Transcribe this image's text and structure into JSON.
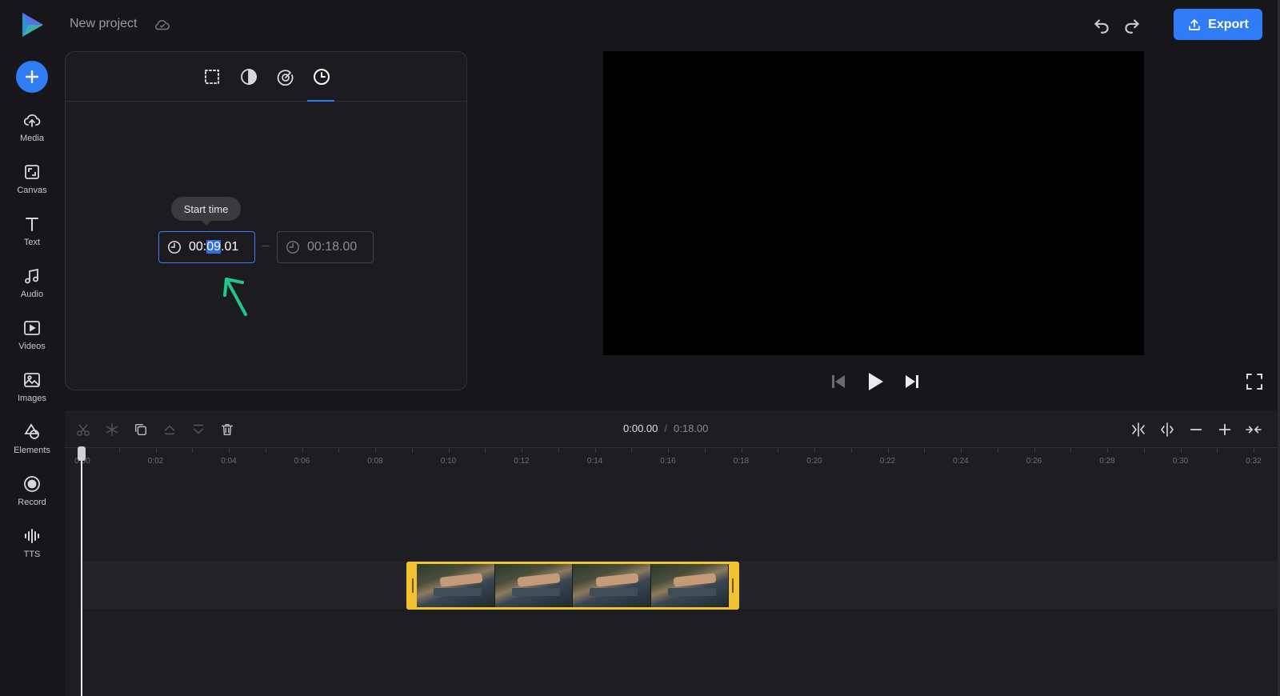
{
  "header": {
    "project_title": "New project",
    "export_label": "Export"
  },
  "sidebar": {
    "items": [
      {
        "label": "Media",
        "icon": "upload-cloud-icon"
      },
      {
        "label": "Canvas",
        "icon": "canvas-icon"
      },
      {
        "label": "Text",
        "icon": "text-icon"
      },
      {
        "label": "Audio",
        "icon": "music-note-icon"
      },
      {
        "label": "Videos",
        "icon": "video-play-icon"
      },
      {
        "label": "Images",
        "icon": "image-icon"
      },
      {
        "label": "Elements",
        "icon": "shapes-icon"
      },
      {
        "label": "Record",
        "icon": "record-icon"
      },
      {
        "label": "TTS",
        "icon": "waveform-icon"
      }
    ]
  },
  "properties": {
    "tabs": [
      "crop-icon",
      "contrast-icon",
      "speed-icon",
      "clock-icon"
    ],
    "active_tab": "clock-icon",
    "tooltip": "Start time",
    "start_time": {
      "prefix": "00:",
      "selected": "09",
      "suffix": ".01"
    },
    "end_time": "00:18.00"
  },
  "timeline": {
    "current_time": "0:00.00",
    "separator": "/",
    "total_time": "0:18.00",
    "ticks": [
      "0:00",
      "0:02",
      "0:04",
      "0:06",
      "0:08",
      "0:10",
      "0:12",
      "0:14",
      "0:16",
      "0:18",
      "0:20",
      "0:22",
      "0:24",
      "0:26",
      "0:28",
      "0:30",
      "0:32"
    ]
  },
  "colors": {
    "accent": "#2f7cf6",
    "clip_border": "#f2c230",
    "annotation_arrow": "#1fc88a"
  }
}
